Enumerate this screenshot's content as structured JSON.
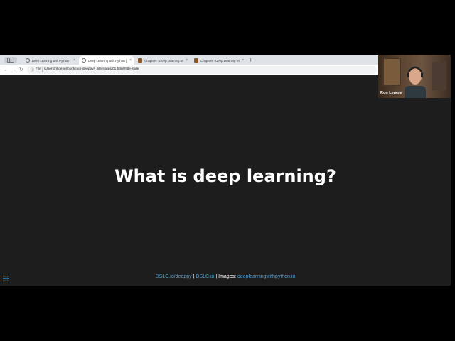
{
  "browser": {
    "tabs": [
      {
        "title": "Deep Learning with Python (",
        "icon": "globe-icon",
        "active": false
      },
      {
        "title": "Deep Learning with Python (",
        "icon": "globe-icon",
        "active": true
      },
      {
        "title": "Chapters - Deep Learning wi",
        "icon": "book-icon",
        "active": false
      },
      {
        "title": "Chapters - Deep Learning wi",
        "icon": "book-icon",
        "active": false
      }
    ],
    "new_tab": "+",
    "close_glyph": "×",
    "address": {
      "scheme_label": "File",
      "url": "/Users/rjl/devel/bookclub-deeppy/_site/slides/01.html#title-slide"
    }
  },
  "slide": {
    "title": "What is deep learning?",
    "footer": {
      "link1": "DSLC.io/deeppy",
      "sep1": " | ",
      "link2": "DSLC.io",
      "sep2": " | ",
      "images_label": "Images: ",
      "link3": "deeplearningwithpython.io"
    }
  },
  "webcam": {
    "name": "Ron Legere"
  },
  "colors": {
    "slide_bg": "#1e1d1d",
    "link": "#4aa3df",
    "tabbar": "#dfe3e8"
  }
}
